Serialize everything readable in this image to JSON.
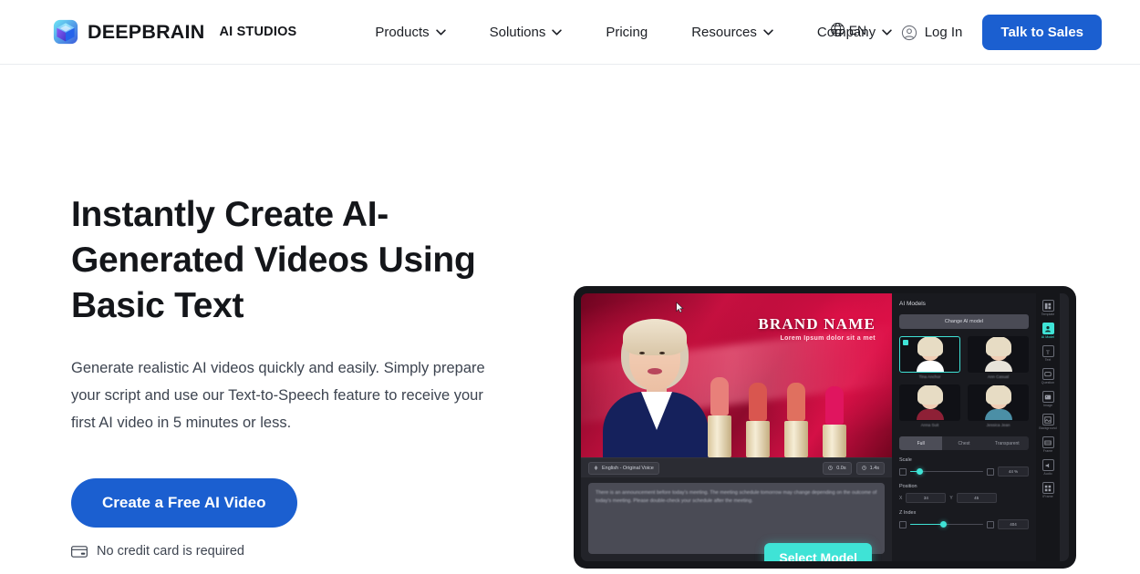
{
  "header": {
    "logo_icon": "cube-logo-icon",
    "brand_name": "DEEPBRAIN",
    "brand_sub": "AI STUDIOS",
    "nav": [
      {
        "label": "Products",
        "has_caret": true
      },
      {
        "label": "Solutions",
        "has_caret": true
      },
      {
        "label": "Pricing",
        "has_caret": false
      },
      {
        "label": "Resources",
        "has_caret": true
      },
      {
        "label": "Company",
        "has_caret": true
      }
    ],
    "language": {
      "icon": "globe-icon",
      "label": "EN"
    },
    "login": {
      "icon": "user-circle-icon",
      "label": "Log In"
    },
    "cta": "Talk to Sales",
    "accent_blue": "#1b5fd0"
  },
  "hero": {
    "title": "Instantly Create AI-Generated Videos Using Basic Text",
    "subtitle": "Generate realistic AI videos quickly and easily. Simply prepare your script and use our Text-to-Speech feature to receive your first AI video in 5 minutes or less.",
    "cta_label": "Create a Free AI Video",
    "note_icon": "credit-card-icon",
    "note": "No credit card is required"
  },
  "product": {
    "video": {
      "brand_title": "BRAND NAME",
      "brand_tagline": "Lorem Ipsum dolor sit a met"
    },
    "toolbar": {
      "voice_icon": "voice-icon",
      "voice_label": "English - Original Voice",
      "time_chip_1": "0.0s",
      "time_chip_2": "1.4s"
    },
    "script_text": "There is an announcement before today's meeting. The meeting schedule tomorrow may change depending on the outcome of today's meeting. Please double-check your schedule after the meeting.",
    "select_model_label": "Select Model",
    "select_model_color": "#3fe3d6",
    "inspector": {
      "title": "AI Models",
      "change_button": "Change AI model",
      "models": [
        {
          "label": "Tina Anchor",
          "selected": true,
          "outfit": "#ffffff"
        },
        {
          "label": "Ann Casual",
          "selected": false,
          "outfit": "#e7e3da"
        },
        {
          "label": "Anna Suit",
          "selected": false,
          "outfit": "#8e2036"
        },
        {
          "label": "Jessica Jean",
          "selected": false,
          "outfit": "#4b8fa6"
        }
      ],
      "segments": [
        {
          "label": "Full",
          "active": true
        },
        {
          "label": "Chest",
          "active": false
        },
        {
          "label": "Transparent",
          "active": false
        }
      ],
      "scale": {
        "label": "Scale",
        "value": "44 %",
        "fill_pct": 12
      },
      "position": {
        "label": "Position",
        "x_label": "X",
        "x_value": "34",
        "y_label": "Y",
        "y_value": "45"
      },
      "zindex": {
        "label": "Z Index",
        "value": "404",
        "fill_pct": 44
      }
    },
    "rail": [
      {
        "label": "Template",
        "icon": "template-icon",
        "active": false
      },
      {
        "label": "AI Model",
        "icon": "ai-model-icon",
        "active": true
      },
      {
        "label": "Text",
        "icon": "text-icon",
        "active": false
      },
      {
        "label": "Question",
        "icon": "question-icon",
        "active": false
      },
      {
        "label": "Image",
        "icon": "image-icon",
        "active": false
      },
      {
        "label": "Background",
        "icon": "background-icon",
        "active": false
      },
      {
        "label": "Frame",
        "icon": "frame-icon",
        "active": false
      },
      {
        "label": "Audio",
        "icon": "audio-icon",
        "active": false
      },
      {
        "label": "IFrame",
        "icon": "iframe-icon",
        "active": false
      }
    ],
    "cursor_icon": "mouse-cursor-icon"
  }
}
